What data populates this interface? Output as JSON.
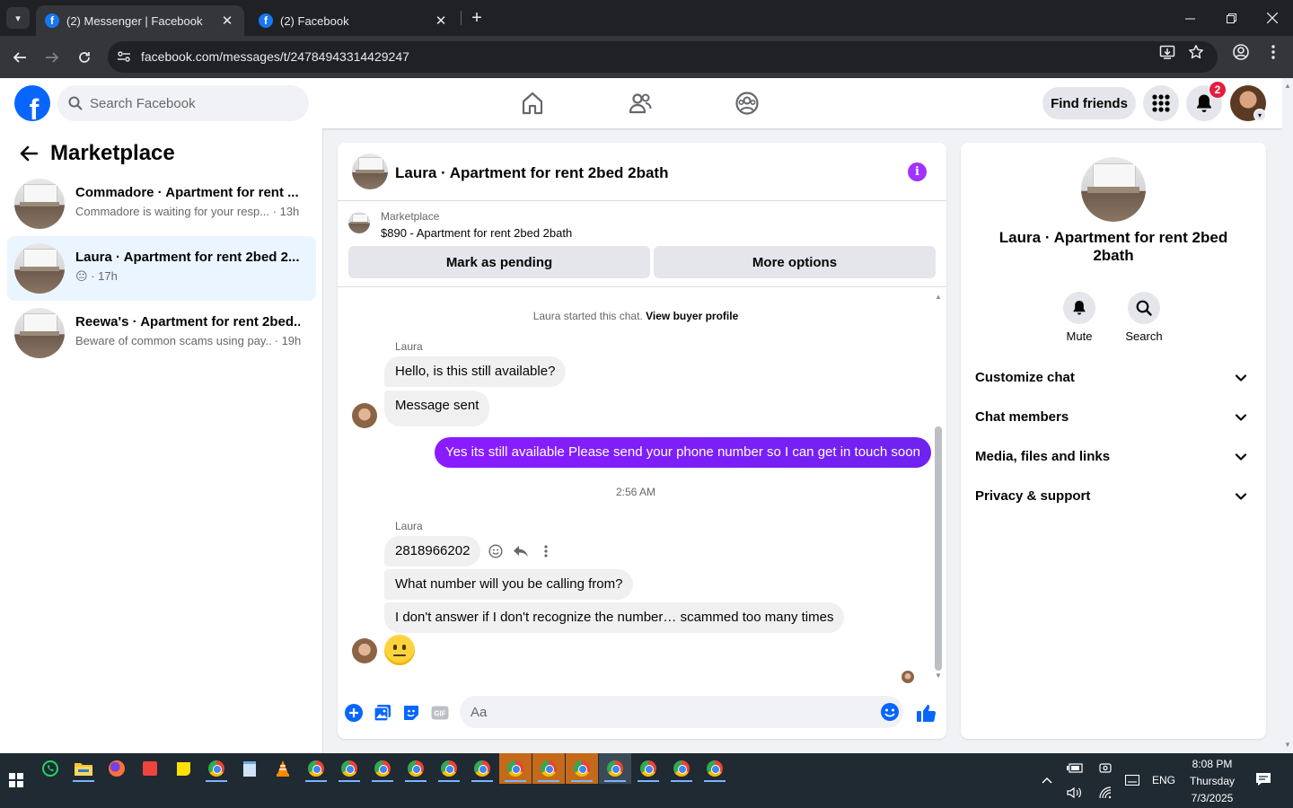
{
  "browser": {
    "tabs": [
      {
        "title": "(2) Messenger | Facebook",
        "active": true
      },
      {
        "title": "(2) Facebook",
        "active": false
      }
    ],
    "url": "facebook.com/messages/t/24784943314429247"
  },
  "fb_header": {
    "search_placeholder": "Search Facebook",
    "find_friends_label": "Find friends",
    "notification_count": "2",
    "brand_color": "#0866ff"
  },
  "sidebar": {
    "title": "Marketplace",
    "conversations": [
      {
        "title": "Commadore · Apartment for rent ...",
        "snippet": "Commadore is waiting for your resp...",
        "time": "· 13h",
        "active": false
      },
      {
        "title": "Laura · Apartment for rent 2bed 2...",
        "snippet": "😐",
        "time": "· 17h",
        "active": true
      },
      {
        "title": "Reewa's · Apartment for rent 2bed...",
        "snippet": "Beware of common scams using pay...",
        "time": "· 19h",
        "active": false
      }
    ]
  },
  "chat": {
    "title": "Laura · Apartment for rent 2bed 2bath",
    "listing": {
      "source": "Marketplace",
      "item": "$890 - Apartment for rent 2bed 2bath",
      "mark_pending_label": "Mark as pending",
      "more_options_label": "More options"
    },
    "system_line": {
      "text": "Laura started this chat.",
      "link": "View buyer profile"
    },
    "messages": [
      {
        "sender": "Laura",
        "text": "Hello, is this still available?"
      },
      {
        "text": "Message sent"
      },
      {
        "own": true,
        "text": "Yes its still available Please send your phone number so I can get in touch soon"
      },
      {
        "sender": "Laura",
        "text": "2818966202"
      },
      {
        "text": "What number will you be calling from?"
      },
      {
        "text": "I don't answer if I don't recognize the number… scammed too many times"
      },
      {
        "emoji": "neutral-face"
      }
    ],
    "timestamp": "2:56 AM",
    "composer_placeholder": "Aa",
    "gif_label": "GIF",
    "accent_color": "#7a1cff"
  },
  "info_panel": {
    "title": "Laura · Apartment for rent 2bed 2bath",
    "actions": [
      {
        "label": "Mute",
        "icon": "bell-icon"
      },
      {
        "label": "Search",
        "icon": "search-icon"
      }
    ],
    "sections": [
      "Customize chat",
      "Chat members",
      "Media, files and links",
      "Privacy & support"
    ]
  },
  "taskbar": {
    "language": "ENG",
    "time": "8:08 PM",
    "day": "Thursday",
    "date": "7/3/2025"
  }
}
